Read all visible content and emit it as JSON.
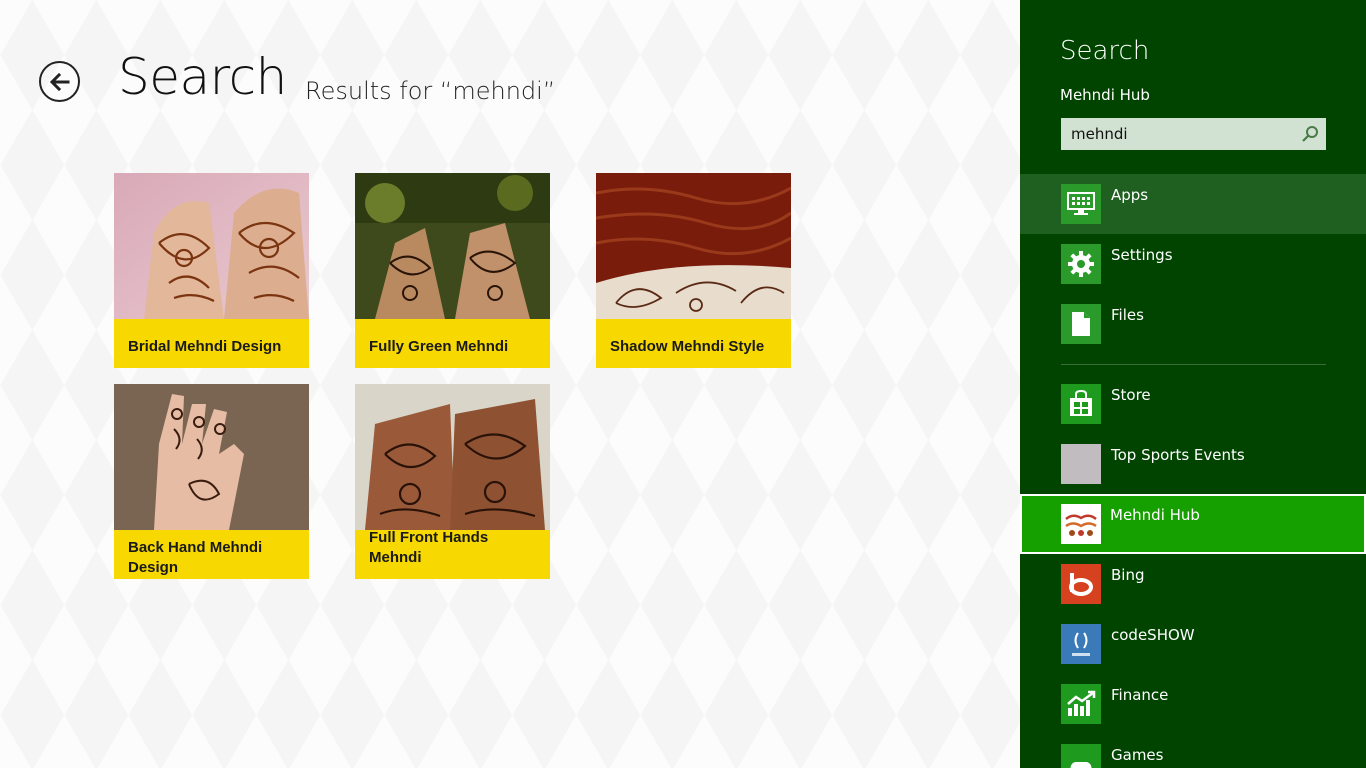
{
  "header": {
    "title": "Search",
    "results_for": "Results for “mehndi”"
  },
  "results": [
    {
      "label": "Bridal Mehndi Design"
    },
    {
      "label": "Fully Green Mehndi"
    },
    {
      "label": "Shadow Mehndi Style"
    },
    {
      "label": "Back Hand Mehndi Design"
    },
    {
      "label": "Full Front Hands Mehndi"
    }
  ],
  "pane": {
    "title": "Search",
    "current_app": "Mehndi Hub",
    "search": {
      "value": "mehndi"
    },
    "scopes": [
      {
        "label": "Apps",
        "icon": "apps-icon"
      },
      {
        "label": "Settings",
        "icon": "gear-icon"
      },
      {
        "label": "Files",
        "icon": "file-icon"
      }
    ],
    "apps": [
      {
        "label": "Store",
        "icon": "store-icon"
      },
      {
        "label": "Top Sports Events",
        "icon": "placeholder-icon"
      },
      {
        "label": "Mehndi Hub",
        "icon": "mehndi-hub-icon"
      },
      {
        "label": "Bing",
        "icon": "bing-icon"
      },
      {
        "label": "codeSHOW",
        "icon": "codeshow-icon"
      },
      {
        "label": "Finance",
        "icon": "finance-icon"
      },
      {
        "label": "Games",
        "icon": "games-icon"
      }
    ]
  },
  "colors": {
    "pane_bg": "#004400",
    "tile_label_bg": "#f7d800",
    "selected_bg": "#16a000",
    "icon_green": "#2a9a2a"
  }
}
